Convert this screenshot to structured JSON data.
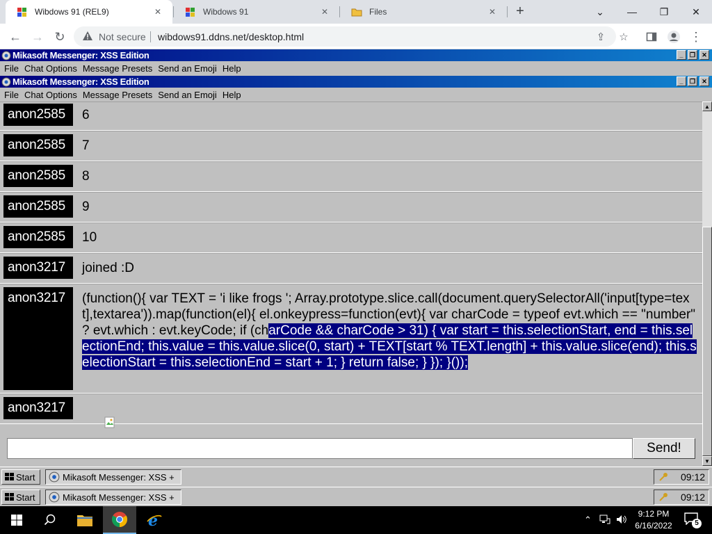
{
  "browser": {
    "tabs": [
      {
        "title": "Wibdows 91 (REL9)",
        "active": true
      },
      {
        "title": "Wibdows 91",
        "active": false
      },
      {
        "title": "Files",
        "active": false
      }
    ],
    "new_tab": "+",
    "security": "Not secure",
    "url": "wibdows91.ddns.net/desktop.html"
  },
  "windows": [
    {
      "title": "Mikasoft Messenger: XSS Edition",
      "menu": [
        "File",
        "Chat Options",
        "Message Presets",
        "Send an Emoji",
        "Help"
      ]
    },
    {
      "title": "Mikasoft Messenger: XSS Edition",
      "menu": [
        "File",
        "Chat Options",
        "Message Presets",
        "Send an Emoji",
        "Help"
      ]
    }
  ],
  "messages": [
    {
      "user": "anon2585",
      "text": "6"
    },
    {
      "user": "anon2585",
      "text": "7"
    },
    {
      "user": "anon2585",
      "text": "8"
    },
    {
      "user": "anon2585",
      "text": "9"
    },
    {
      "user": "anon2585",
      "text": "10"
    },
    {
      "user": "anon3217",
      "text": "joined :D"
    },
    {
      "user": "anon3217",
      "text_plain": "(function(){ var TEXT = 'i like frogs '; Array.prototype.slice.call(document.querySelectorAll('input[type=text],textarea')).map(function(el){ el.onkeypress=function(evt){ var charCode = typeof evt.which == \"number\" ? evt.which : evt.keyCode; if (ch",
      "text_selected": "arCode && charCode > 31) { var start = this.selectionStart, end = this.selectionEnd; this.value = this.value.slice(0, start) + TEXT[start % TEXT.length] + this.value.slice(end); this.selectionStart = this.selectionEnd = start + 1; } return false; } }); }());"
    },
    {
      "user": "anon3217",
      "text": ""
    }
  ],
  "composer": {
    "value": "",
    "send_label": "Send!"
  },
  "w91_taskbars": [
    {
      "start": "Start",
      "item": "Mikasoft Messenger: XSS +",
      "time": "09:12"
    },
    {
      "start": "Start",
      "item": "Mikasoft Messenger: XSS +",
      "time": "09:12"
    }
  ],
  "win10": {
    "time": "9:12 PM",
    "date": "6/16/2022",
    "notifications": "5"
  }
}
